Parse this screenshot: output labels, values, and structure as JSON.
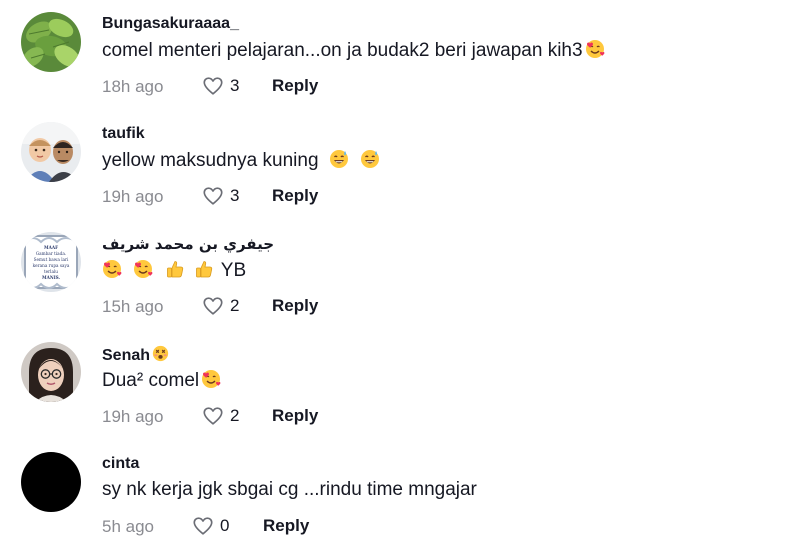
{
  "comments": [
    {
      "username": "Bungasakuraaaa_",
      "text": "comel menteri pelajaran...on ja budak2 beri jawapan kih3",
      "time": "18h ago",
      "likes": "3",
      "reply": "Reply",
      "avatar": "green-leaves"
    },
    {
      "username": "taufik",
      "text": "yellow maksudnya kuning",
      "time": "19h ago",
      "likes": "3",
      "reply": "Reply",
      "avatar": "father-and-child"
    },
    {
      "username": "جيفري بن محمد شريف",
      "text": "YB",
      "time": "15h ago",
      "likes": "2",
      "reply": "Reply",
      "avatar": "framed-text",
      "avatar_text": [
        "MAAF",
        "Gambar tiada.",
        "Semut bawa lari",
        "kerana rupa saya",
        "terlalu",
        "MANIS."
      ]
    },
    {
      "username": "Senah",
      "text": "Dua² comel",
      "time": "19h ago",
      "likes": "2",
      "reply": "Reply",
      "avatar": "woman-glasses"
    },
    {
      "username": "cinta",
      "text": "sy nk kerja jgk sbgai cg ...rindu time mngajar",
      "time": "5h ago",
      "likes": "0",
      "reply": "Reply",
      "avatar": "black-circle"
    }
  ],
  "icons": {
    "like": "heart-outline-icon",
    "emoji_love": "smiling-face-with-hearts-icon",
    "emoji_grin": "grinning-sweat-icon",
    "emoji_thumb": "thumbs-up-icon",
    "emoji_dizzy": "dizzy-face-icon"
  },
  "colors": {
    "text": "#161823",
    "meta": "#8a8b91",
    "emoji_face": "#FFC83D",
    "emoji_heart": "#F0335A"
  }
}
